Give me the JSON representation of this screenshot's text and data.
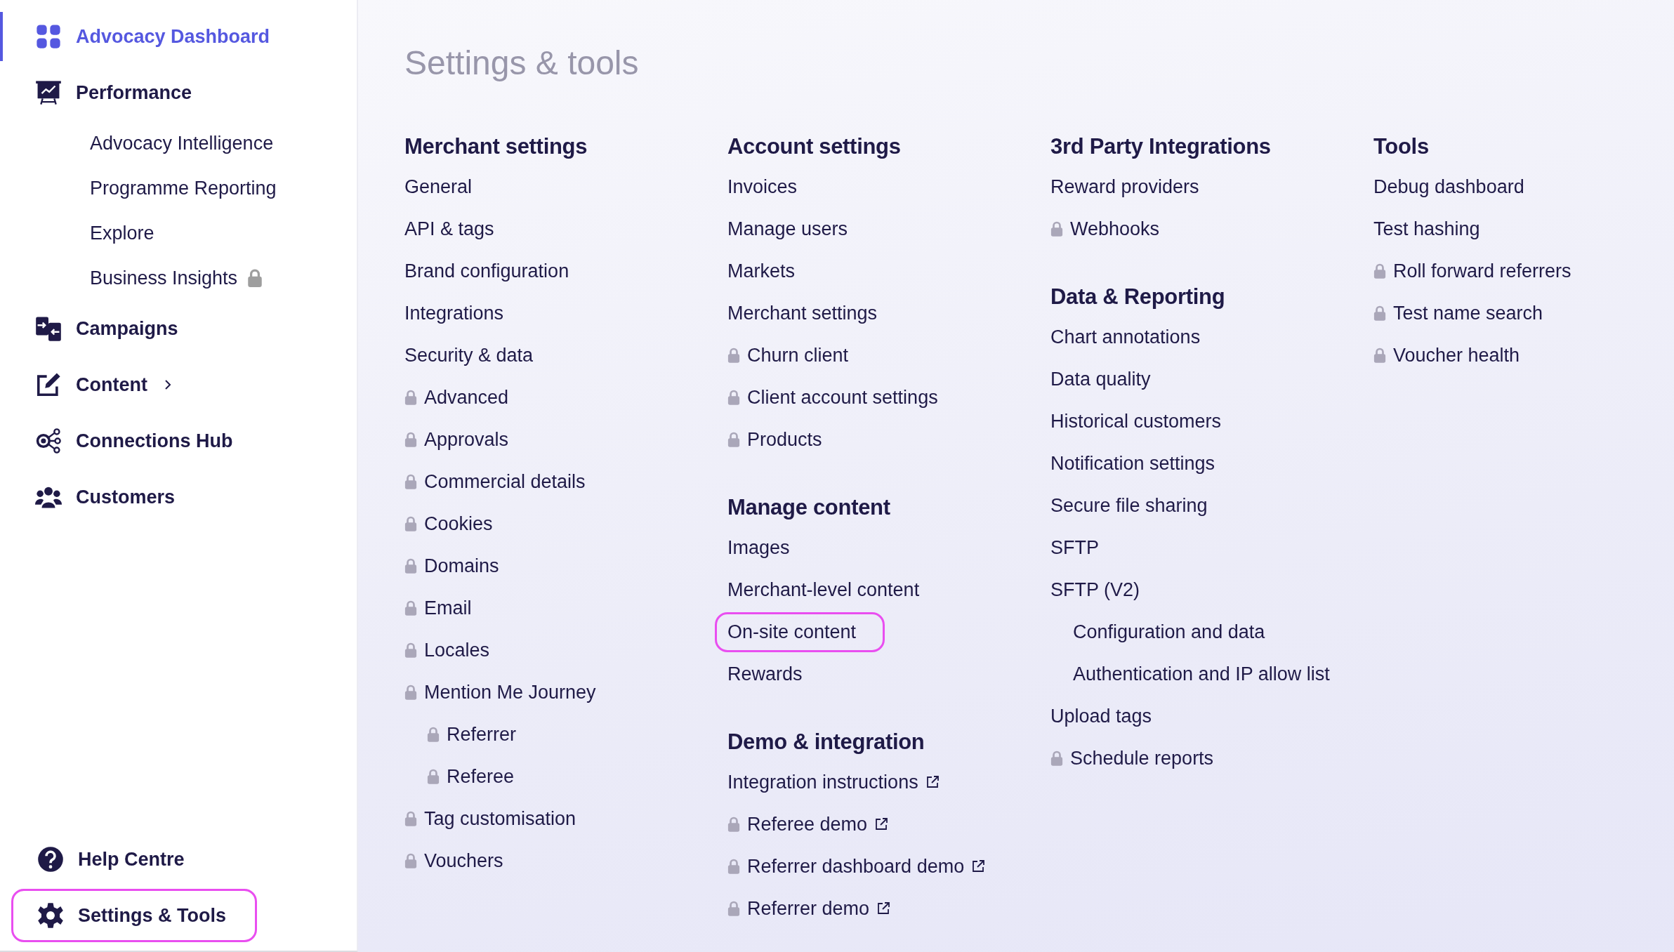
{
  "sidebar": {
    "items": [
      {
        "label": "Advocacy Dashboard",
        "selected": true,
        "highlighted": false,
        "expandable": false,
        "locked": false
      },
      {
        "label": "Performance",
        "selected": false,
        "highlighted": false,
        "expandable": false,
        "locked": false,
        "children": [
          {
            "label": "Advocacy Intelligence",
            "locked": false
          },
          {
            "label": "Programme Reporting",
            "locked": false
          },
          {
            "label": "Explore",
            "locked": false
          },
          {
            "label": "Business Insights",
            "locked": true
          }
        ]
      },
      {
        "label": "Campaigns",
        "selected": false,
        "highlighted": false,
        "expandable": false,
        "locked": false
      },
      {
        "label": "Content",
        "selected": false,
        "highlighted": false,
        "expandable": true,
        "locked": false
      },
      {
        "label": "Connections Hub",
        "selected": false,
        "highlighted": false,
        "expandable": false,
        "locked": false
      },
      {
        "label": "Customers",
        "selected": false,
        "highlighted": false,
        "expandable": false,
        "locked": false
      }
    ],
    "footer_items": [
      {
        "label": "Help Centre",
        "selected": false,
        "highlighted": false
      },
      {
        "label": "Settings & Tools",
        "selected": false,
        "highlighted": true
      }
    ]
  },
  "page": {
    "title": "Settings & tools"
  },
  "columns": [
    {
      "sections": [
        {
          "title": "Merchant settings",
          "items": [
            {
              "label": "General",
              "locked": false,
              "external": false,
              "highlighted": false
            },
            {
              "label": "API & tags",
              "locked": false,
              "external": false,
              "highlighted": false
            },
            {
              "label": "Brand configuration",
              "locked": false,
              "external": false,
              "highlighted": false
            },
            {
              "label": "Integrations",
              "locked": false,
              "external": false,
              "highlighted": false
            },
            {
              "label": "Security & data",
              "locked": false,
              "external": false,
              "highlighted": false
            },
            {
              "label": "Advanced",
              "locked": true,
              "external": false,
              "highlighted": false
            },
            {
              "label": "Approvals",
              "locked": true,
              "external": false,
              "highlighted": false
            },
            {
              "label": "Commercial details",
              "locked": true,
              "external": false,
              "highlighted": false
            },
            {
              "label": "Cookies",
              "locked": true,
              "external": false,
              "highlighted": false
            },
            {
              "label": "Domains",
              "locked": true,
              "external": false,
              "highlighted": false
            },
            {
              "label": "Email",
              "locked": true,
              "external": false,
              "highlighted": false
            },
            {
              "label": "Locales",
              "locked": true,
              "external": false,
              "highlighted": false
            },
            {
              "label": "Mention Me Journey",
              "locked": true,
              "external": false,
              "highlighted": false,
              "children": [
                {
                  "label": "Referrer",
                  "locked": true
                },
                {
                  "label": "Referee",
                  "locked": true
                }
              ]
            },
            {
              "label": "Tag customisation",
              "locked": true,
              "external": false,
              "highlighted": false
            },
            {
              "label": "Vouchers",
              "locked": true,
              "external": false,
              "highlighted": false
            }
          ]
        }
      ]
    },
    {
      "sections": [
        {
          "title": "Account settings",
          "items": [
            {
              "label": "Invoices",
              "locked": false,
              "external": false,
              "highlighted": false
            },
            {
              "label": "Manage users",
              "locked": false,
              "external": false,
              "highlighted": false
            },
            {
              "label": "Markets",
              "locked": false,
              "external": false,
              "highlighted": false
            },
            {
              "label": "Merchant settings",
              "locked": false,
              "external": false,
              "highlighted": false
            },
            {
              "label": "Churn client",
              "locked": true,
              "external": false,
              "highlighted": false
            },
            {
              "label": "Client account settings",
              "locked": true,
              "external": false,
              "highlighted": false
            },
            {
              "label": "Products",
              "locked": true,
              "external": false,
              "highlighted": false
            }
          ]
        },
        {
          "title": "Manage content",
          "items": [
            {
              "label": "Images",
              "locked": false,
              "external": false,
              "highlighted": false
            },
            {
              "label": "Merchant-level content",
              "locked": false,
              "external": false,
              "highlighted": false
            },
            {
              "label": "On-site content",
              "locked": false,
              "external": false,
              "highlighted": true
            },
            {
              "label": "Rewards",
              "locked": false,
              "external": false,
              "highlighted": false
            }
          ]
        },
        {
          "title": "Demo & integration",
          "items": [
            {
              "label": "Integration instructions",
              "locked": false,
              "external": true,
              "highlighted": false
            },
            {
              "label": "Referee demo",
              "locked": true,
              "external": true,
              "highlighted": false
            },
            {
              "label": "Referrer dashboard demo",
              "locked": true,
              "external": true,
              "highlighted": false
            },
            {
              "label": "Referrer demo",
              "locked": true,
              "external": true,
              "highlighted": false
            }
          ]
        }
      ]
    },
    {
      "sections": [
        {
          "title": "3rd Party Integrations",
          "items": [
            {
              "label": "Reward providers",
              "locked": false,
              "external": false,
              "highlighted": false
            },
            {
              "label": "Webhooks",
              "locked": true,
              "external": false,
              "highlighted": false
            }
          ]
        },
        {
          "title": "Data & Reporting",
          "items": [
            {
              "label": "Chart annotations",
              "locked": false,
              "external": false,
              "highlighted": false
            },
            {
              "label": "Data quality",
              "locked": false,
              "external": false,
              "highlighted": false
            },
            {
              "label": "Historical customers",
              "locked": false,
              "external": false,
              "highlighted": false
            },
            {
              "label": "Notification settings",
              "locked": false,
              "external": false,
              "highlighted": false
            },
            {
              "label": "Secure file sharing",
              "locked": false,
              "external": false,
              "highlighted": false
            },
            {
              "label": "SFTP",
              "locked": false,
              "external": false,
              "highlighted": false
            },
            {
              "label": "SFTP (V2)",
              "locked": false,
              "external": false,
              "highlighted": false,
              "children": [
                {
                  "label": "Configuration and data",
                  "locked": false
                },
                {
                  "label": "Authentication and IP allow list",
                  "locked": false
                }
              ]
            },
            {
              "label": "Upload tags",
              "locked": false,
              "external": false,
              "highlighted": false
            },
            {
              "label": "Schedule reports",
              "locked": true,
              "external": false,
              "highlighted": false
            }
          ]
        }
      ]
    },
    {
      "sections": [
        {
          "title": "Tools",
          "items": [
            {
              "label": "Debug dashboard",
              "locked": false,
              "external": false,
              "highlighted": false
            },
            {
              "label": "Test hashing",
              "locked": false,
              "external": false,
              "highlighted": false
            },
            {
              "label": "Roll forward referrers",
              "locked": true,
              "external": false,
              "highlighted": false
            },
            {
              "label": "Test name search",
              "locked": true,
              "external": false,
              "highlighted": false
            },
            {
              "label": "Voucher health",
              "locked": true,
              "external": false,
              "highlighted": false
            }
          ]
        }
      ]
    }
  ]
}
